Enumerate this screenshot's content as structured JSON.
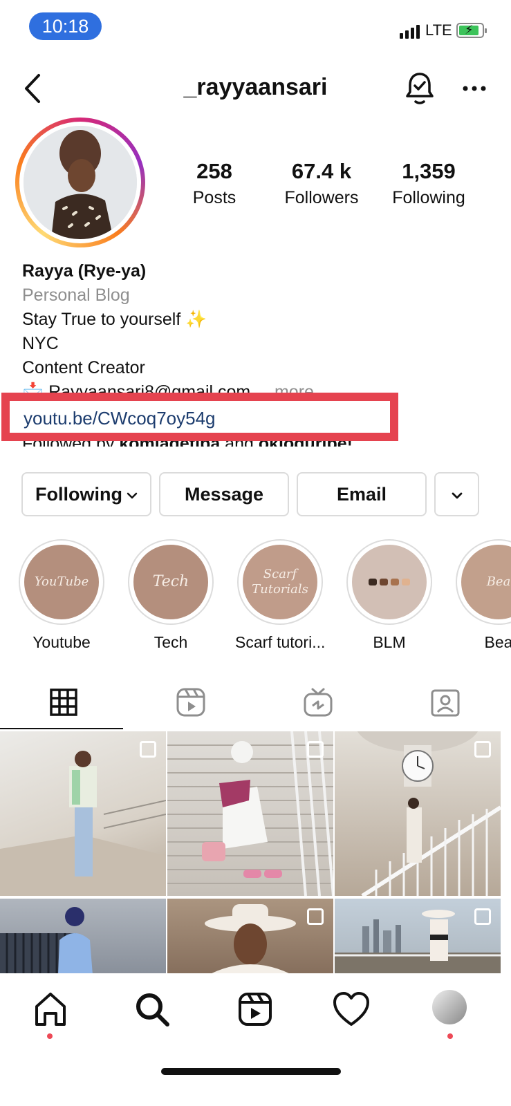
{
  "status_bar": {
    "time": "10:18",
    "network": "LTE",
    "time_pill_color": "#2f6fdf"
  },
  "header": {
    "username": "_rayyaansari",
    "back_icon": "chevron-left-icon",
    "bell_icon": "bell-check-icon",
    "more_icon": "ellipsis-icon"
  },
  "profile": {
    "stats": [
      {
        "value": "258",
        "label": "Posts"
      },
      {
        "value": "67.4 k",
        "label": "Followers"
      },
      {
        "value": "1,359",
        "label": "Following"
      }
    ],
    "name": "Rayya (Rye-ya)",
    "category": "Personal Blog",
    "bio_lines": [
      "Stay True to yourself ✨",
      "NYC",
      "Content Creator"
    ],
    "email_line": "📩 Rayyaansari8@gmail.com",
    "more_label": "... more",
    "link": "youtu.be/CWcoq7oy54g",
    "followed_by": {
      "prefix": "Followed by ",
      "user1": "komiadetiba",
      "joiner": " and ",
      "user2": "okloguribe!"
    },
    "ring_colors": [
      "#d62976",
      "#962fbf",
      "#fa7e1e",
      "#feda75"
    ]
  },
  "annotation": {
    "highlight_color": "#e5434f"
  },
  "actions": {
    "following": "Following",
    "message": "Message",
    "email": "Email",
    "chevron": "chevron-down-icon"
  },
  "highlights": [
    {
      "label": "Youtube",
      "cover_text": "YouTube",
      "color": "#b48f7d"
    },
    {
      "label": "Tech",
      "cover_text": "Tech",
      "color": "#b48f7d"
    },
    {
      "label": "Scarf tutori...",
      "cover_text": "Scarf Tutorials",
      "color": "#c09c8a"
    },
    {
      "label": "BLM",
      "cover_text": "",
      "color": "#d2bfb5"
    },
    {
      "label": "Bea",
      "cover_text": "Bea",
      "color": "#c2a08c"
    }
  ],
  "tabs": [
    "grid-icon",
    "reels-icon",
    "igtv-icon",
    "tagged-icon"
  ],
  "posts": [
    {
      "name": "post-stairs-light",
      "colors": [
        "#e7e3dd",
        "#c8beb2"
      ]
    },
    {
      "name": "post-stairs-white-dress",
      "colors": [
        "#d7d2cc",
        "#9e9790"
      ]
    },
    {
      "name": "post-clock-balcony",
      "colors": [
        "#d8d2ca",
        "#9d8f81"
      ]
    },
    {
      "name": "post-blue-shirt",
      "colors": [
        "#b5b9bf",
        "#3c4250"
      ]
    },
    {
      "name": "post-white-hat",
      "colors": [
        "#a8917c",
        "#3a2b22"
      ]
    },
    {
      "name": "post-skyline",
      "colors": [
        "#b8c4cf",
        "#6e6a62"
      ]
    }
  ],
  "bottom_nav": [
    "home-icon",
    "search-icon",
    "reels-icon",
    "heart-icon",
    "profile-avatar"
  ]
}
